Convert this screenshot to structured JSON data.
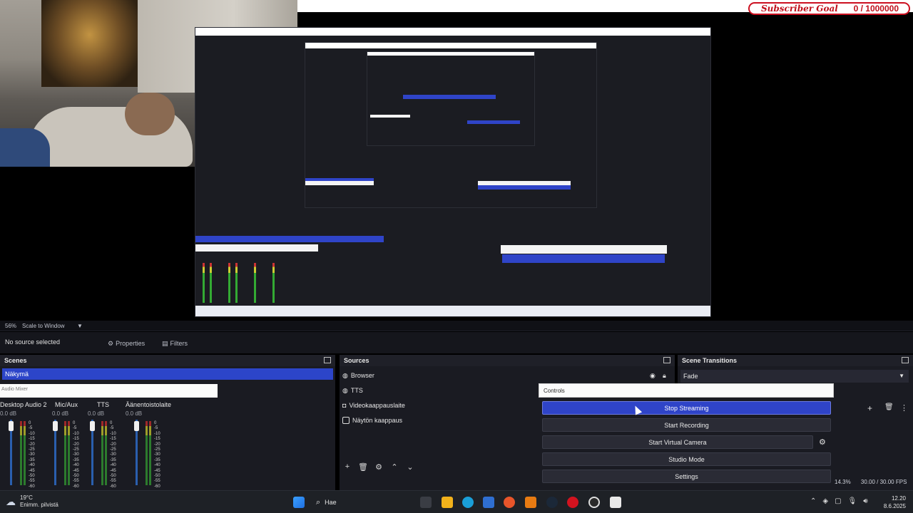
{
  "overlay": {
    "goal_title": "Subscriber Goal",
    "goal_value": "0 / 1000000"
  },
  "status": {
    "zoom": "56%",
    "scale_mode": "Scale to Window"
  },
  "source_toolbar": {
    "selection": "No source selected",
    "properties_label": "Properties",
    "filters_label": "Filters"
  },
  "scenes": {
    "title": "Scenes",
    "items": [
      "Näkymä"
    ]
  },
  "audio_mixer": {
    "title": "Audio Mixer",
    "channels": [
      {
        "name": "Desktop Audio 2",
        "db": "0.0 dB"
      },
      {
        "name": "Mic/Aux",
        "db": "0.0 dB"
      },
      {
        "name": "TTS",
        "db": "0.0 dB"
      },
      {
        "name": "Äänentoistolaite",
        "db": "0.0 dB"
      }
    ],
    "scale": [
      "0",
      "-5",
      "-10",
      "-15",
      "-20",
      "-25",
      "-30",
      "-35",
      "-40",
      "-45",
      "-50",
      "-55",
      "-60"
    ]
  },
  "sources": {
    "title": "Sources",
    "items": [
      "Browser",
      "TTS",
      "Videokaappauslaite",
      "Näytön kaappaus"
    ]
  },
  "transitions": {
    "title": "Scene Transitions",
    "selected": "Fade"
  },
  "controls": {
    "title": "Controls",
    "buttons": [
      "Stop Streaming",
      "Start Recording",
      "Start Virtual Camera",
      "Studio Mode",
      "Settings"
    ]
  },
  "stats": {
    "cpu": "14.3%",
    "fps": "30.00 / 30.00 FPS"
  },
  "taskbar": {
    "weather_temp": "19°C",
    "weather_desc": "Enimm. pilvistä",
    "search_placeholder": "Hae",
    "time": "12.20",
    "date": "8.6.2025"
  },
  "colors": {
    "accent": "#2f44c8",
    "panel": "#1a1b22",
    "goal_red": "#cc1020"
  }
}
